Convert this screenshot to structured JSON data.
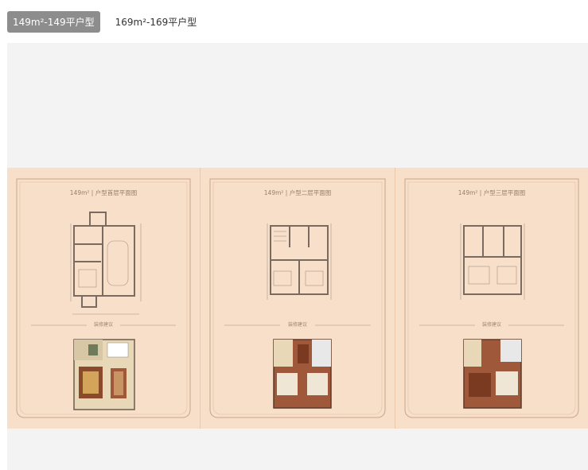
{
  "tabs": [
    {
      "label": "149m²-149平户型",
      "active": true
    },
    {
      "label": "169m²-169平户型",
      "active": false
    }
  ],
  "panels": [
    {
      "title": "149m²  |  户型首层平面图",
      "deco": "装修建议"
    },
    {
      "title": "149m²  |  户型二层平面图",
      "deco": "装修建议"
    },
    {
      "title": "149m²  |  户型三层平面图",
      "deco": "装修建议"
    }
  ],
  "colors": {
    "active_tab": "#8d8d8d",
    "viewer_bg": "#f3f3f3",
    "panel_bg": "#f8dfc9",
    "frame_line": "#c8a58c",
    "floor_wood": "#a0583a",
    "floor_tile": "#e8d8b8"
  }
}
